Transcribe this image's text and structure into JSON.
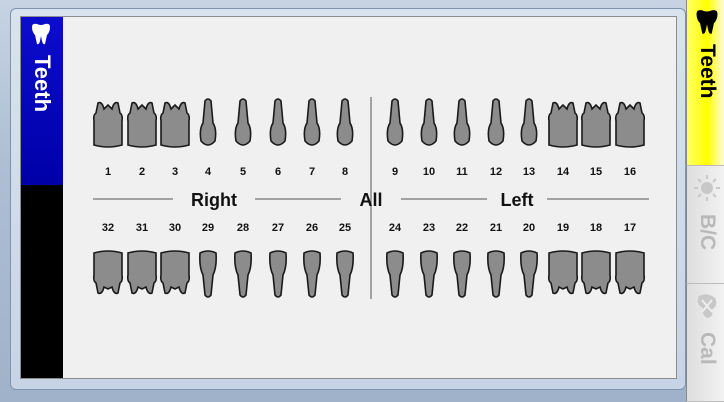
{
  "panel": {
    "title": "Teeth"
  },
  "chart": {
    "upper_numbers": [
      "1",
      "2",
      "3",
      "4",
      "5",
      "6",
      "7",
      "8",
      "9",
      "10",
      "11",
      "12",
      "13",
      "14",
      "15",
      "16"
    ],
    "lower_numbers": [
      "32",
      "31",
      "30",
      "29",
      "28",
      "27",
      "26",
      "25",
      "24",
      "23",
      "22",
      "21",
      "20",
      "19",
      "18",
      "17"
    ],
    "side_labels": {
      "right": "Right",
      "all": "All",
      "left": "Left"
    }
  },
  "tabs": [
    {
      "label": "Teeth",
      "icon": "tooth-icon",
      "active": true
    },
    {
      "label": "B/C",
      "icon": "sun-icon",
      "active": false
    },
    {
      "label": "Cal",
      "icon": "calculus-icon",
      "active": false
    }
  ],
  "colors": {
    "tooth_fill": "#8c8c8c",
    "tooth_stroke": "#1a1a1a",
    "header_blue": "#0000b0",
    "active_tab": "#ffff00"
  }
}
